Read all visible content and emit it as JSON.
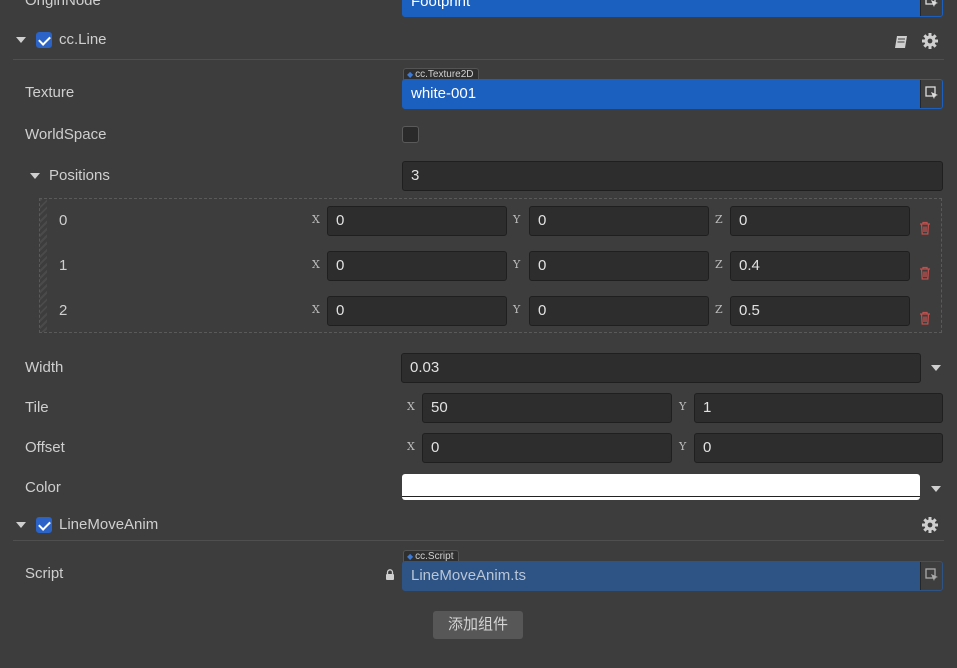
{
  "origin_node": {
    "label": "OriginNode",
    "value": "Footprint"
  },
  "line_component": {
    "name": "cc.Line",
    "enabled": true,
    "texture": {
      "label": "Texture",
      "type_tag": "cc.Texture2D",
      "value": "white-001"
    },
    "world_space": {
      "label": "WorldSpace",
      "checked": false
    },
    "positions": {
      "label": "Positions",
      "count": "3",
      "items": [
        {
          "index": "0",
          "x": "0",
          "y": "0",
          "z": "0"
        },
        {
          "index": "1",
          "x": "0",
          "y": "0",
          "z": "0.4"
        },
        {
          "index": "2",
          "x": "0",
          "y": "0",
          "z": "0.5"
        }
      ]
    },
    "width": {
      "label": "Width",
      "value": "0.03"
    },
    "tile": {
      "label": "Tile",
      "x": "50",
      "y": "1"
    },
    "offset": {
      "label": "Offset",
      "x": "0",
      "y": "0"
    },
    "color": {
      "label": "Color",
      "value": "#ffffff"
    }
  },
  "anim_component": {
    "name": "LineMoveAnim",
    "enabled": true,
    "script": {
      "label": "Script",
      "type_tag": "cc.Script",
      "value": "LineMoveAnim.ts"
    }
  },
  "axis_labels": {
    "x": "X",
    "y": "Y",
    "z": "Z"
  },
  "add_component_label": "添加组件",
  "colors": {
    "panel_bg": "#3d3d3d",
    "field_bg": "#2d2d2d",
    "asset_blue": "#1b5fbf",
    "script_blue": "#2e5385",
    "trash_red": "#c0504d"
  }
}
